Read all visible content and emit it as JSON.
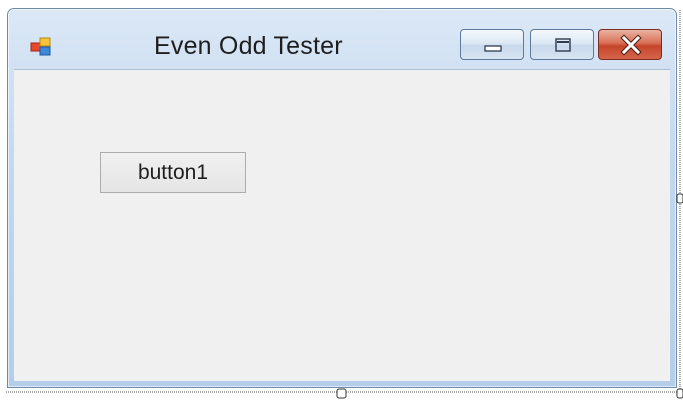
{
  "window": {
    "title": "Even Odd Tester",
    "icon": "winforms-app-icon",
    "controls": [
      "minimize-icon",
      "maximize-icon",
      "close-icon"
    ]
  },
  "form": {
    "button1_label": "button1"
  },
  "colors": {
    "frame": "#c3d8ef",
    "client_background": "#f0f0f0",
    "close_button": "#c5462c"
  }
}
